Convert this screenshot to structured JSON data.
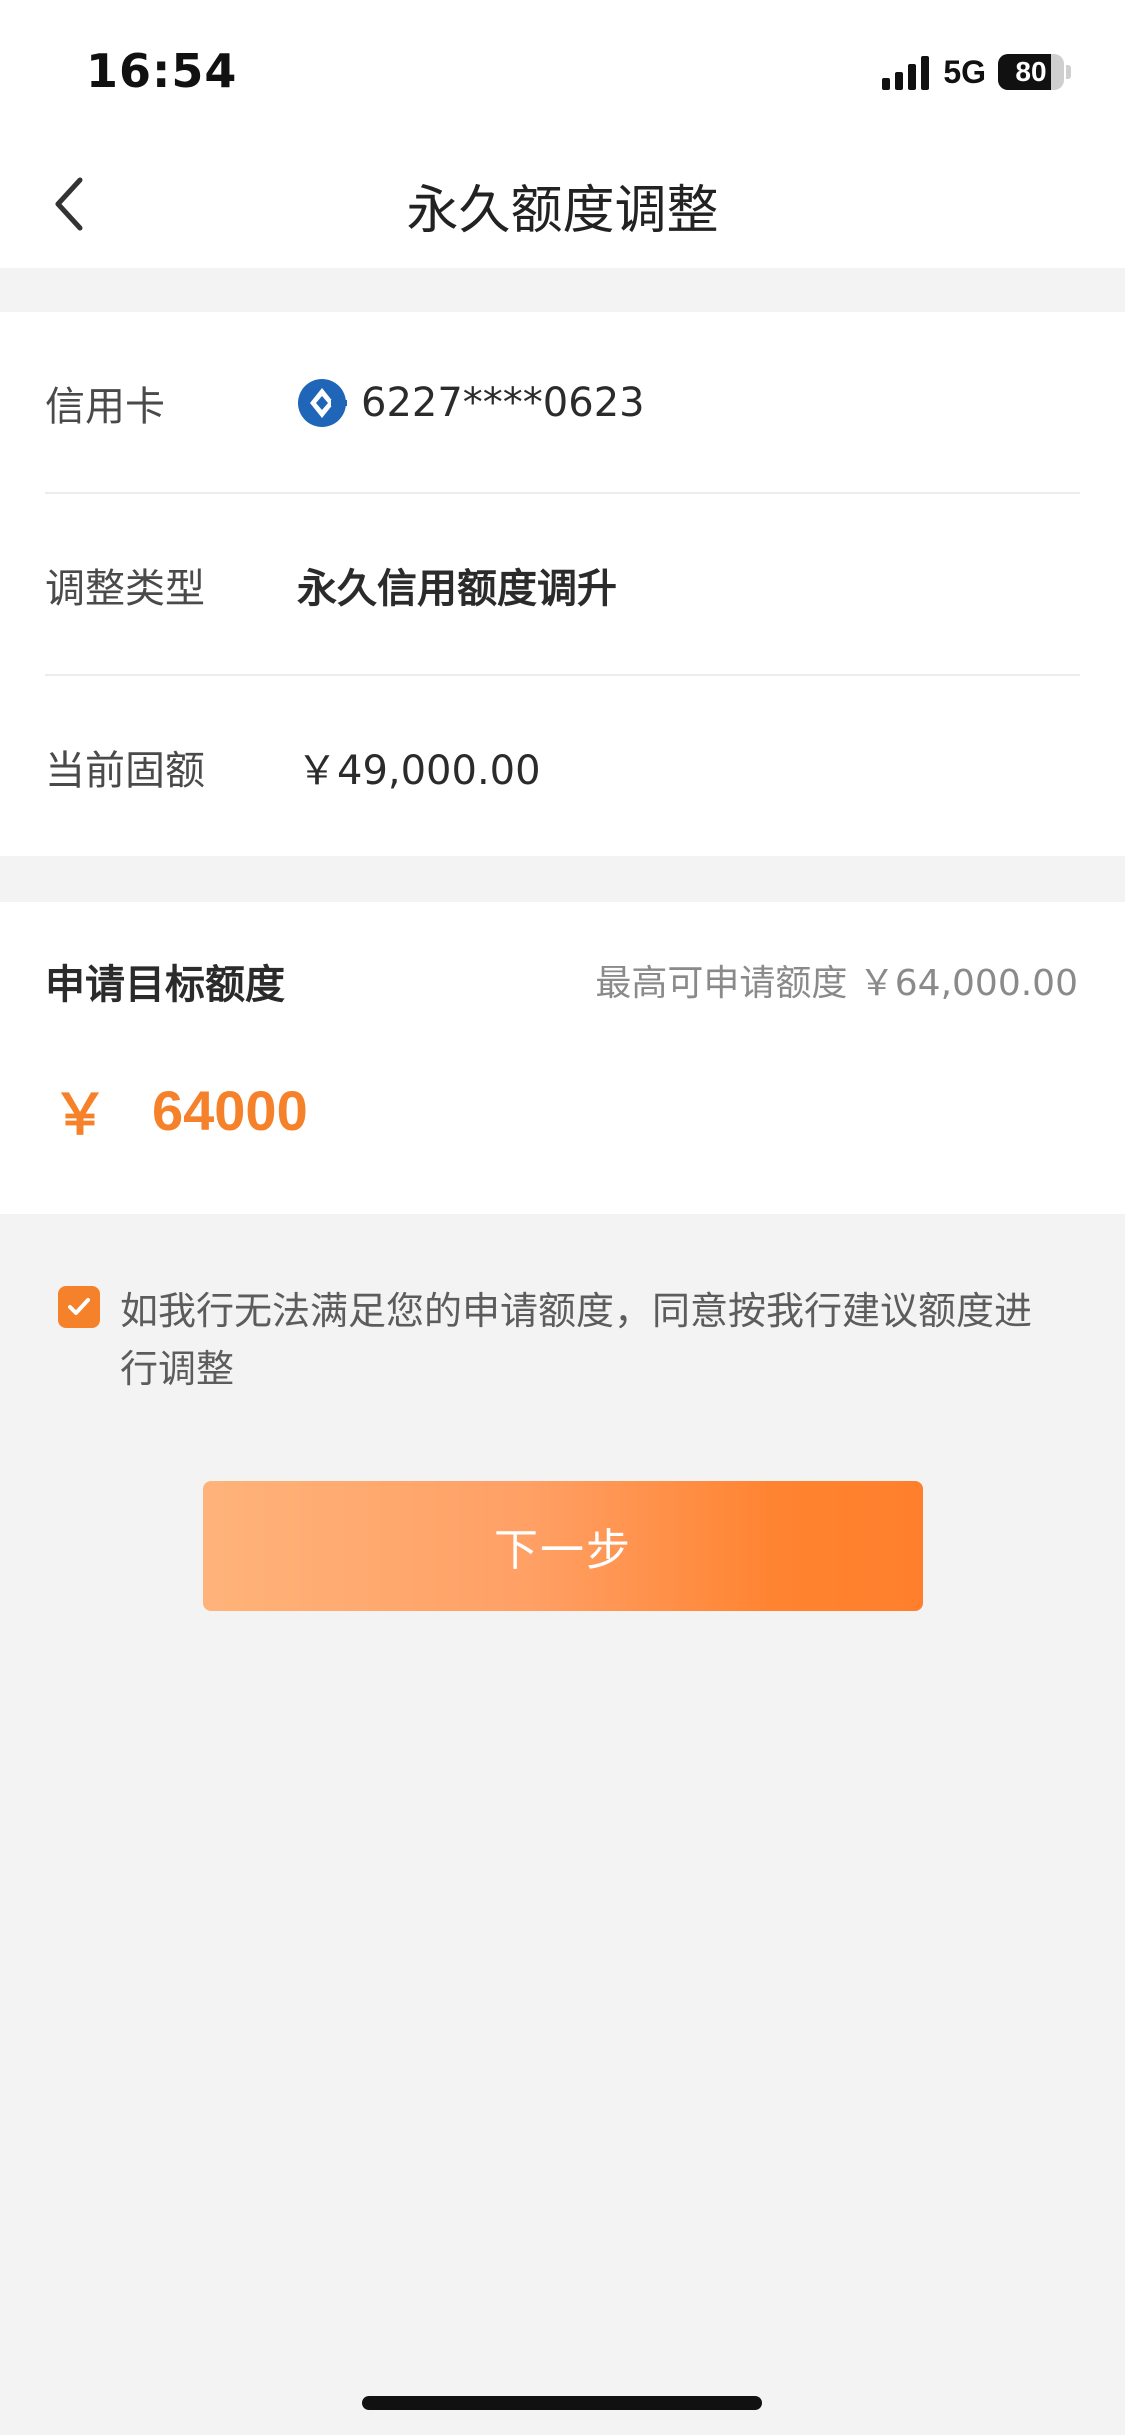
{
  "status_bar": {
    "time": "16:54",
    "network": "5G",
    "battery": "80",
    "battery_level": 0.8,
    "signal_icon": "signal-bars-icon"
  },
  "nav": {
    "title": "永久额度调整",
    "back_icon": "chevron-left-icon"
  },
  "info": {
    "card_label": "信用卡",
    "card_number": "6227****0623",
    "bank_icon": "ccb-bank-logo-icon",
    "type_label": "调整类型",
    "type_value": "永久信用额度调升",
    "current_label": "当前固额",
    "current_value": "￥49,000.00"
  },
  "target": {
    "label": "申请目标额度",
    "max_label": "最高可申请额度 ￥64,000.00",
    "currency": "￥",
    "amount": "64000"
  },
  "agreement": {
    "checked": true,
    "text": "如我行无法满足您的申请额度，同意按我行建议额度进行调整"
  },
  "actions": {
    "next_label": "下一步"
  },
  "colors": {
    "accent": "#f5822a",
    "background": "#f3f3f3",
    "bank_blue": "#1f66b8"
  }
}
